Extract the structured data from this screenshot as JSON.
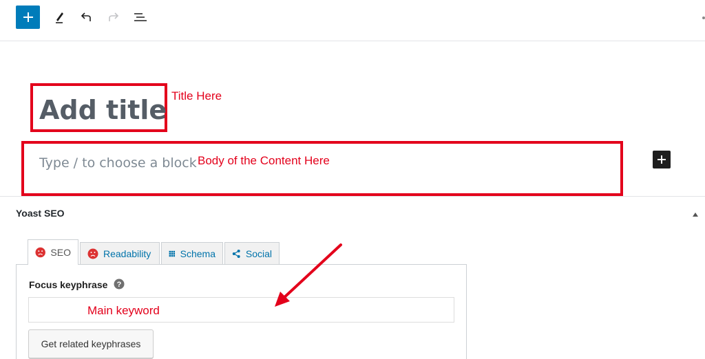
{
  "toolbar": {
    "add_icon": "plus-icon",
    "edit_icon": "pencil-icon",
    "undo_icon": "undo-icon",
    "redo_icon": "redo-icon",
    "outline_icon": "list-view-icon",
    "accent": "#007cba"
  },
  "editor": {
    "title_placeholder": "Add title",
    "body_placeholder": "Type / to choose a block"
  },
  "annotations": {
    "title": "Title Here",
    "body": "Body of the Content Here",
    "keyword": "Main keyword",
    "color": "#e3001b"
  },
  "yoast": {
    "panel_title": "Yoast SEO",
    "tabs": [
      {
        "label": "SEO",
        "icon": "sad-face-icon",
        "active": true
      },
      {
        "label": "Readability",
        "icon": "sad-face-icon",
        "active": false
      },
      {
        "label": "Schema",
        "icon": "grid-icon",
        "active": false
      },
      {
        "label": "Social",
        "icon": "share-icon",
        "active": false
      }
    ],
    "focus_keyphrase_label": "Focus keyphrase",
    "focus_keyphrase_value": "",
    "related_button_label": "Get related keyphrases"
  }
}
